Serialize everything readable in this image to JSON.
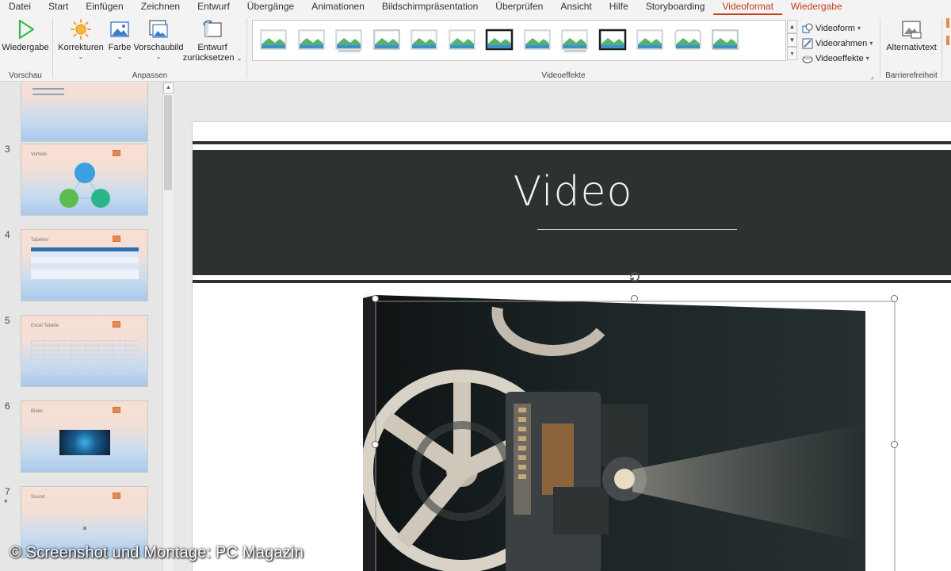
{
  "menu": {
    "tabs": [
      "Datei",
      "Start",
      "Einfügen",
      "Zeichnen",
      "Entwurf",
      "Übergänge",
      "Animationen",
      "Bildschirmpräsentation",
      "Überprüfen",
      "Ansicht",
      "Hilfe",
      "Storyboarding",
      "Videoformat",
      "Wiedergabe"
    ],
    "active_tab": "Videoformat"
  },
  "ribbon": {
    "vorschau": {
      "play_label": "Wiedergabe",
      "group_label": "Vorschau"
    },
    "anpassen": {
      "corrections_label": "Korrekturen",
      "color_label": "Farbe",
      "poster_label": "Vorschaubild",
      "reset_label_1": "Entwurf",
      "reset_label_2": "zurücksetzen",
      "group_label": "Anpassen"
    },
    "videoeffekte": {
      "group_label": "Videoeffekte",
      "style_count": 13,
      "shape_label": "Videoform",
      "border_label": "Videorahmen",
      "effects_label": "Videoeffekte"
    },
    "barrierefreiheit": {
      "alt_text_label": "Alternativtext",
      "group_label": "Barrierefreiheit"
    }
  },
  "thumbnails": [
    {
      "number": "",
      "title": ""
    },
    {
      "number": "3",
      "title": "Vorteile"
    },
    {
      "number": "4",
      "title": "Tabellen"
    },
    {
      "number": "5",
      "title": "Excel Tabelle"
    },
    {
      "number": "6",
      "title": "Bilder"
    },
    {
      "number": "7",
      "title": "Sound",
      "marker": "*"
    }
  ],
  "slide": {
    "title": "Video"
  },
  "watermark": "© Screenshot und Montage: PC Magazin",
  "colors": {
    "accent": "#c43e1c",
    "title_band": "#2e3132",
    "play_green": "#3cb54a"
  }
}
